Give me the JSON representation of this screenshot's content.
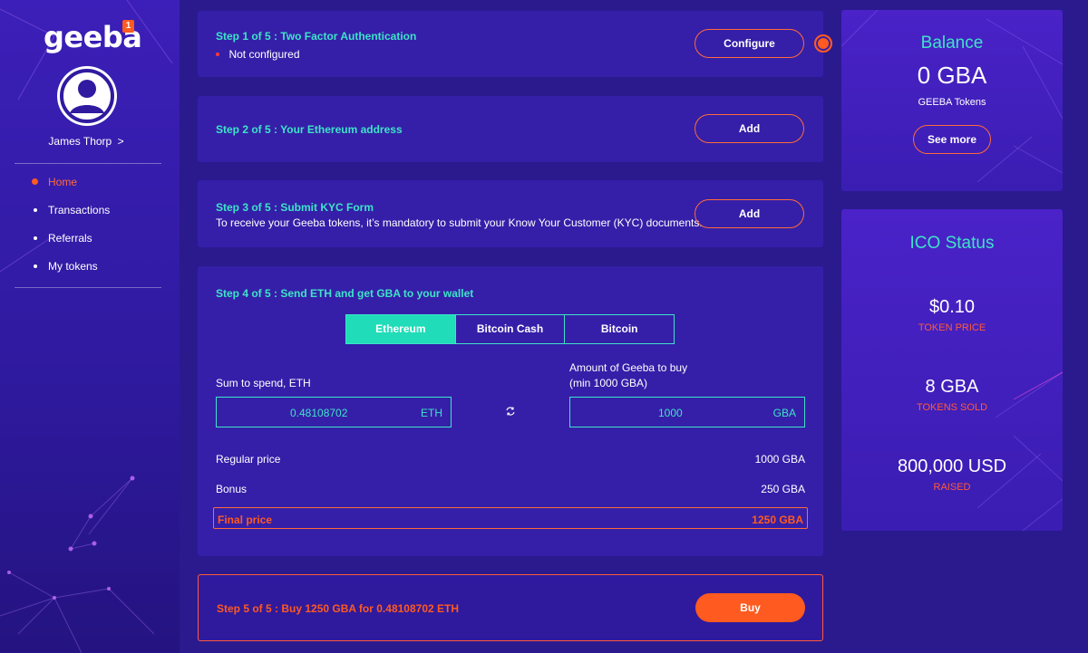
{
  "sidebar": {
    "logo": "geeba",
    "logo_badge": "1",
    "user_name": "James Thorp",
    "user_chevron": ">",
    "nav": [
      {
        "label": "Home",
        "active": true
      },
      {
        "label": "Transactions",
        "active": false
      },
      {
        "label": "Referrals",
        "active": false
      },
      {
        "label": "My tokens",
        "active": false
      }
    ]
  },
  "steps": {
    "step1": {
      "title": "Step 1 of 5 : Two Factor Authentication",
      "status": "Not configured",
      "button": "Configure"
    },
    "step2": {
      "title": "Step 2 of 5 : Your Ethereum address",
      "button": "Add"
    },
    "step3": {
      "title": "Step 3 of 5 : Submit KYC Form",
      "description": "To receive your Geeba tokens, it’s mandatory to submit your Know Your Customer (KYC) documents.",
      "button": "Add"
    },
    "step4": {
      "title": "Step 4 of 5 : Send ETH and get GBA to your wallet",
      "tabs": [
        "Ethereum",
        "Bitcoin Cash",
        "Bitcoin"
      ],
      "active_tab": "Ethereum",
      "spend_label": "Sum to spend, ETH",
      "spend_value": "0.48108702",
      "spend_unit": "ETH",
      "buy_label_line1": "Amount of Geeba to buy",
      "buy_label_line2": "(min 1000 GBA)",
      "buy_value": "1000",
      "buy_unit": "GBA",
      "regular_price_label": "Regular price",
      "regular_price_value": "1000 GBA",
      "bonus_label": "Bonus",
      "bonus_value": "250 GBA",
      "final_price_label": "Final price",
      "final_price_value": "1250 GBA"
    },
    "step5": {
      "title": "Step 5 of 5 : Buy 1250 GBA for 0.48108702 ETH",
      "button": "Buy"
    }
  },
  "balance": {
    "title": "Balance",
    "value": "0 GBA",
    "subtitle": "GEEBA Tokens",
    "button": "See more"
  },
  "ico": {
    "title": "ICO Status",
    "token_price_value": "$0.10",
    "token_price_label": "TOKEN PRICE",
    "tokens_sold_value": "8 GBA",
    "tokens_sold_label": "TOKENS SOLD",
    "raised_value": "800,000 USD",
    "raised_label": "RAISED"
  },
  "colors": {
    "background": "#2a1a8e",
    "panel": "#351fa8",
    "accent_teal": "#3ee3c8",
    "accent_orange": "#ff5a1f"
  }
}
